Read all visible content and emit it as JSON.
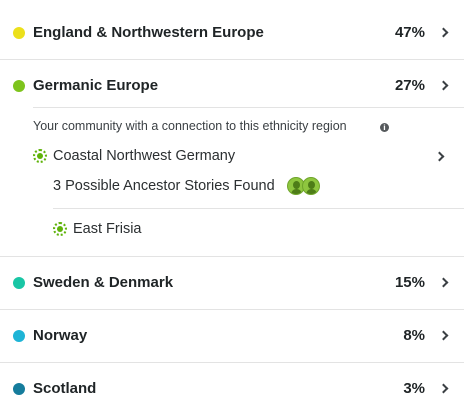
{
  "regions": [
    {
      "name": "England & Northwestern Europe",
      "percent": "47%",
      "color": "#ece01b"
    },
    {
      "name": "Germanic Europe",
      "percent": "27%",
      "color": "#7ec41d"
    },
    {
      "name": "Sweden & Denmark",
      "percent": "15%",
      "color": "#19c6a5"
    },
    {
      "name": "Norway",
      "percent": "8%",
      "color": "#1eb4d6"
    },
    {
      "name": "Scotland",
      "percent": "3%",
      "color": "#157c9c"
    }
  ],
  "germanic_detail": {
    "caption": "Your community with a connection to this ethnicity region",
    "info_icon": "i",
    "community": "Coastal Northwest Germany",
    "stories": "3 Possible Ancestor Stories Found",
    "sub_community": "East Frisia",
    "community_color": "#5fb30a"
  }
}
